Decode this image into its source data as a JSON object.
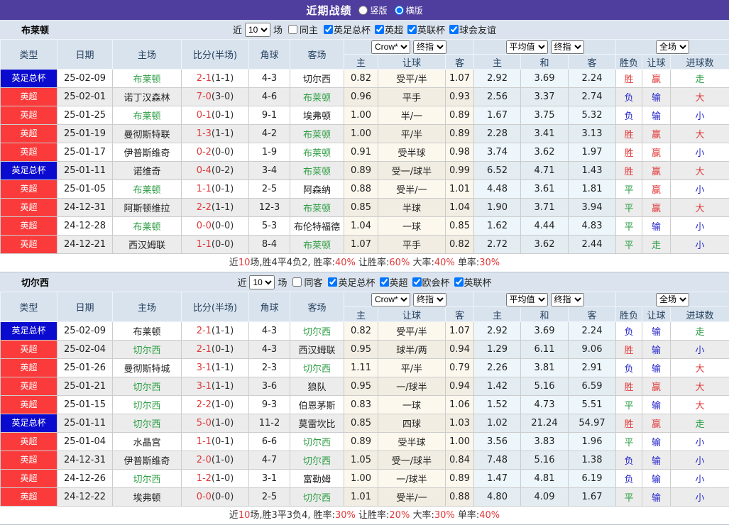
{
  "colors": {
    "topbar": "#4f3e9d",
    "type_blue": "#0b0bd0",
    "type_red": "#fb3b3b",
    "red": "#e03a3a",
    "blue": "#2727cc",
    "green": "#2e9e44"
  },
  "topbar": {
    "title": "近期战绩",
    "radio_vertical": "竖版",
    "radio_horizontal": "横版"
  },
  "table_header": {
    "selects": {
      "odds1": "Crow*",
      "odds2": "终指",
      "avg1": "平均值",
      "avg2": "终指",
      "scope": "全场"
    },
    "cols": {
      "type": "类型",
      "date": "日期",
      "home": "主场",
      "score": "比分(半场)",
      "corner": "角球",
      "away": "客场",
      "odds_home": "主",
      "odds_handicap": "让球",
      "odds_away": "客",
      "avg_home": "主",
      "avg_draw": "和",
      "avg_away": "客",
      "result": "胜负",
      "handicap_result": "让球",
      "goals": "进球数"
    }
  },
  "sections": [
    {
      "team": "布莱顿",
      "filter": {
        "near": "近",
        "count": "10",
        "games": "场",
        "same": "同主",
        "leagues": [
          "英足总杯",
          "英超",
          "英联杯",
          "球会友谊"
        ]
      },
      "rows": [
        {
          "type": "英足总杯",
          "tc": "blue",
          "date": "25-02-09",
          "home": "布莱顿",
          "score": "2-1",
          "half": "(1-1)",
          "corner": "4-3",
          "away": "切尔西",
          "odds": [
            "0.82",
            "受平/半",
            "1.07"
          ],
          "avg": [
            "2.92",
            "3.69",
            "2.24"
          ],
          "res": [
            "胜",
            "赢",
            "走"
          ]
        },
        {
          "type": "英超",
          "tc": "red",
          "date": "25-02-01",
          "home": "诺丁汉森林",
          "score": "7-0",
          "half": "(3-0)",
          "corner": "4-6",
          "away": "布莱顿",
          "odds": [
            "0.96",
            "平手",
            "0.93"
          ],
          "avg": [
            "2.56",
            "3.37",
            "2.74"
          ],
          "res": [
            "负",
            "输",
            "大"
          ]
        },
        {
          "type": "英超",
          "tc": "red",
          "date": "25-01-25",
          "home": "布莱顿",
          "score": "0-1",
          "half": "(0-1)",
          "corner": "9-1",
          "away": "埃弗顿",
          "odds": [
            "1.00",
            "半/一",
            "0.89"
          ],
          "avg": [
            "1.67",
            "3.75",
            "5.32"
          ],
          "res": [
            "负",
            "输",
            "小"
          ]
        },
        {
          "type": "英超",
          "tc": "red",
          "date": "25-01-19",
          "home": "曼彻斯特联",
          "score": "1-3",
          "half": "(1-1)",
          "corner": "4-2",
          "away": "布莱顿",
          "odds": [
            "1.00",
            "平/半",
            "0.89"
          ],
          "avg": [
            "2.28",
            "3.41",
            "3.13"
          ],
          "res": [
            "胜",
            "赢",
            "大"
          ]
        },
        {
          "type": "英超",
          "tc": "red",
          "date": "25-01-17",
          "home": "伊普斯维奇",
          "score": "0-2",
          "half": "(0-0)",
          "corner": "1-9",
          "away": "布莱顿",
          "odds": [
            "0.91",
            "受半球",
            "0.98"
          ],
          "avg": [
            "3.74",
            "3.62",
            "1.97"
          ],
          "res": [
            "胜",
            "赢",
            "小"
          ]
        },
        {
          "type": "英足总杯",
          "tc": "blue",
          "date": "25-01-11",
          "home": "诺维奇",
          "score": "0-4",
          "half": "(0-2)",
          "corner": "3-4",
          "away": "布莱顿",
          "odds": [
            "0.89",
            "受一/球半",
            "0.99"
          ],
          "avg": [
            "6.52",
            "4.71",
            "1.43"
          ],
          "res": [
            "胜",
            "赢",
            "大"
          ]
        },
        {
          "type": "英超",
          "tc": "red",
          "date": "25-01-05",
          "home": "布莱顿",
          "score": "1-1",
          "half": "(0-1)",
          "corner": "2-5",
          "away": "阿森纳",
          "odds": [
            "0.88",
            "受半/一",
            "1.01"
          ],
          "avg": [
            "4.48",
            "3.61",
            "1.81"
          ],
          "res": [
            "平",
            "赢",
            "小"
          ]
        },
        {
          "type": "英超",
          "tc": "red",
          "date": "24-12-31",
          "home": "阿斯顿维拉",
          "score": "2-2",
          "half": "(1-1)",
          "corner": "12-3",
          "away": "布莱顿",
          "odds": [
            "0.85",
            "半球",
            "1.04"
          ],
          "avg": [
            "1.90",
            "3.71",
            "3.94"
          ],
          "res": [
            "平",
            "赢",
            "大"
          ]
        },
        {
          "type": "英超",
          "tc": "red",
          "date": "24-12-28",
          "home": "布莱顿",
          "score": "0-0",
          "half": "(0-0)",
          "corner": "5-3",
          "away": "布伦特福德",
          "odds": [
            "1.04",
            "一球",
            "0.85"
          ],
          "avg": [
            "1.62",
            "4.44",
            "4.83"
          ],
          "res": [
            "平",
            "输",
            "小"
          ]
        },
        {
          "type": "英超",
          "tc": "red",
          "date": "24-12-21",
          "home": "西汉姆联",
          "score": "1-1",
          "half": "(0-0)",
          "corner": "8-4",
          "away": "布莱顿",
          "odds": [
            "1.07",
            "平手",
            "0.82"
          ],
          "avg": [
            "2.72",
            "3.62",
            "2.44"
          ],
          "res": [
            "平",
            "走",
            "小"
          ]
        }
      ],
      "summary": [
        [
          "近",
          "k"
        ],
        [
          "10",
          "r"
        ],
        [
          "场,胜4平4负2, 胜率:",
          "k"
        ],
        [
          "40%",
          "r"
        ],
        [
          " 让胜率:",
          "k"
        ],
        [
          "60%",
          "r"
        ],
        [
          " 大率:",
          "k"
        ],
        [
          "40%",
          "r"
        ],
        [
          " 单率:",
          "k"
        ],
        [
          "30%",
          "r"
        ]
      ]
    },
    {
      "team": "切尔西",
      "filter": {
        "near": "近",
        "count": "10",
        "games": "场",
        "same": "同客",
        "leagues": [
          "英足总杯",
          "英超",
          "欧会杯",
          "英联杯"
        ]
      },
      "rows": [
        {
          "type": "英足总杯",
          "tc": "blue",
          "date": "25-02-09",
          "home": "布莱顿",
          "score": "2-1",
          "half": "(1-1)",
          "corner": "4-3",
          "away": "切尔西",
          "odds": [
            "0.82",
            "受平/半",
            "1.07"
          ],
          "avg": [
            "2.92",
            "3.69",
            "2.24"
          ],
          "res": [
            "负",
            "输",
            "走"
          ]
        },
        {
          "type": "英超",
          "tc": "red",
          "date": "25-02-04",
          "home": "切尔西",
          "score": "2-1",
          "half": "(0-1)",
          "corner": "4-3",
          "away": "西汉姆联",
          "odds": [
            "0.95",
            "球半/两",
            "0.94"
          ],
          "avg": [
            "1.29",
            "6.11",
            "9.06"
          ],
          "res": [
            "胜",
            "输",
            "小"
          ]
        },
        {
          "type": "英超",
          "tc": "red",
          "date": "25-01-26",
          "home": "曼彻斯特城",
          "score": "3-1",
          "half": "(1-1)",
          "corner": "2-3",
          "away": "切尔西",
          "odds": [
            "1.11",
            "平/半",
            "0.79"
          ],
          "avg": [
            "2.26",
            "3.81",
            "2.91"
          ],
          "res": [
            "负",
            "输",
            "大"
          ]
        },
        {
          "type": "英超",
          "tc": "red",
          "date": "25-01-21",
          "home": "切尔西",
          "score": "3-1",
          "half": "(1-1)",
          "corner": "3-6",
          "away": "狼队",
          "odds": [
            "0.95",
            "一/球半",
            "0.94"
          ],
          "avg": [
            "1.42",
            "5.16",
            "6.59"
          ],
          "res": [
            "胜",
            "赢",
            "大"
          ]
        },
        {
          "type": "英超",
          "tc": "red",
          "date": "25-01-15",
          "home": "切尔西",
          "score": "2-2",
          "half": "(1-0)",
          "corner": "9-3",
          "away": "伯恩茅斯",
          "odds": [
            "0.83",
            "一球",
            "1.06"
          ],
          "avg": [
            "1.52",
            "4.73",
            "5.51"
          ],
          "res": [
            "平",
            "输",
            "大"
          ]
        },
        {
          "type": "英足总杯",
          "tc": "blue",
          "date": "25-01-11",
          "home": "切尔西",
          "score": "5-0",
          "half": "(1-0)",
          "corner": "11-2",
          "away": "莫雷坎比",
          "odds": [
            "0.85",
            "四球",
            "1.03"
          ],
          "avg": [
            "1.02",
            "21.24",
            "54.97"
          ],
          "res": [
            "胜",
            "赢",
            "走"
          ]
        },
        {
          "type": "英超",
          "tc": "red",
          "date": "25-01-04",
          "home": "水晶宫",
          "score": "1-1",
          "half": "(0-1)",
          "corner": "6-6",
          "away": "切尔西",
          "odds": [
            "0.89",
            "受半球",
            "1.00"
          ],
          "avg": [
            "3.56",
            "3.83",
            "1.96"
          ],
          "res": [
            "平",
            "输",
            "小"
          ]
        },
        {
          "type": "英超",
          "tc": "red",
          "date": "24-12-31",
          "home": "伊普斯维奇",
          "score": "2-0",
          "half": "(1-0)",
          "corner": "4-7",
          "away": "切尔西",
          "odds": [
            "1.05",
            "受一/球半",
            "0.84"
          ],
          "avg": [
            "7.48",
            "5.16",
            "1.38"
          ],
          "res": [
            "负",
            "输",
            "小"
          ]
        },
        {
          "type": "英超",
          "tc": "red",
          "date": "24-12-26",
          "home": "切尔西",
          "score": "1-2",
          "half": "(1-0)",
          "corner": "3-1",
          "away": "富勒姆",
          "odds": [
            "1.00",
            "一/球半",
            "0.89"
          ],
          "avg": [
            "1.47",
            "4.81",
            "6.19"
          ],
          "res": [
            "负",
            "输",
            "小"
          ]
        },
        {
          "type": "英超",
          "tc": "red",
          "date": "24-12-22",
          "home": "埃弗顿",
          "score": "0-0",
          "half": "(0-0)",
          "corner": "2-5",
          "away": "切尔西",
          "odds": [
            "1.01",
            "受半/一",
            "0.88"
          ],
          "avg": [
            "4.80",
            "4.09",
            "1.67"
          ],
          "res": [
            "平",
            "输",
            "小"
          ]
        }
      ],
      "summary": [
        [
          "近",
          "k"
        ],
        [
          "10",
          "r"
        ],
        [
          "场,胜3平3负4, 胜率:",
          "k"
        ],
        [
          "30%",
          "r"
        ],
        [
          " 让胜率:",
          "k"
        ],
        [
          "20%",
          "r"
        ],
        [
          " 大率:",
          "k"
        ],
        [
          "30%",
          "r"
        ],
        [
          " 单率:",
          "k"
        ],
        [
          "40%",
          "r"
        ]
      ]
    }
  ]
}
